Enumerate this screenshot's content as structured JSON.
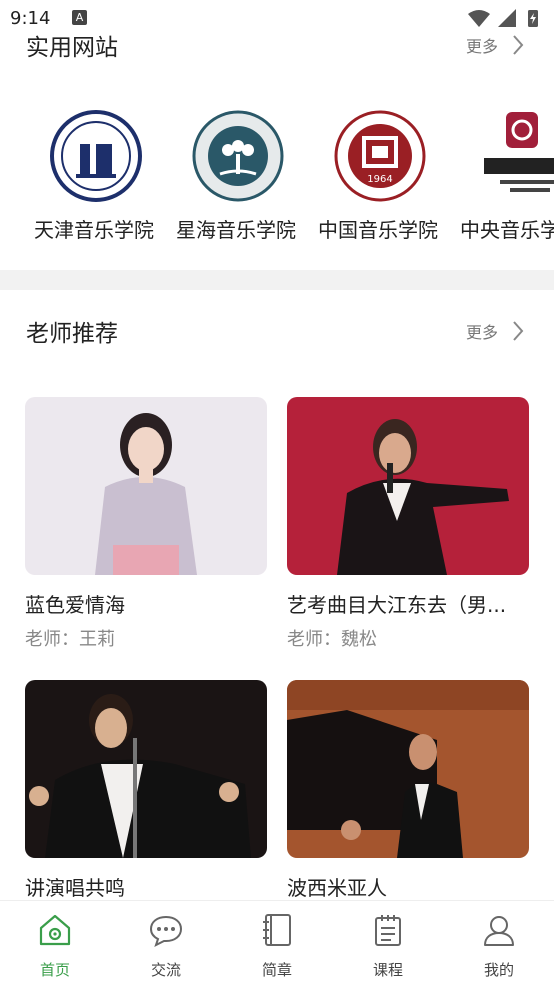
{
  "status_bar": {
    "time": "9:14",
    "notification_letter": "A"
  },
  "sites_section": {
    "title": "实用网站",
    "more": "更多",
    "items": [
      {
        "name": "天津音乐学院",
        "logo_color": "#1d2f6b"
      },
      {
        "name": "星海音乐学院",
        "logo_color": "#2a5868"
      },
      {
        "name": "中国音乐学院",
        "logo_color": "#9a1f24",
        "logo_text": "1964"
      },
      {
        "name": "中央音乐学院",
        "logo_color": "#a11f3a"
      }
    ]
  },
  "teachers_section": {
    "title": "老师推荐",
    "more": "更多",
    "cards": [
      {
        "title": "蓝色爱情海",
        "teacher": "老师：王莉"
      },
      {
        "title": "艺考曲目大江东去（男...",
        "teacher": "老师：魏松"
      },
      {
        "title": "讲演唱共鸣",
        "teacher": ""
      },
      {
        "title": "波西米亚人",
        "teacher": ""
      }
    ]
  },
  "tab_bar": {
    "items": [
      {
        "label": "首页",
        "icon": "home-icon",
        "active": true
      },
      {
        "label": "交流",
        "icon": "chat-icon",
        "active": false
      },
      {
        "label": "简章",
        "icon": "notebook-icon",
        "active": false
      },
      {
        "label": "课程",
        "icon": "calendar-icon",
        "active": false
      },
      {
        "label": "我的",
        "icon": "user-icon",
        "active": false
      }
    ],
    "active_color": "#3a9e4a"
  }
}
